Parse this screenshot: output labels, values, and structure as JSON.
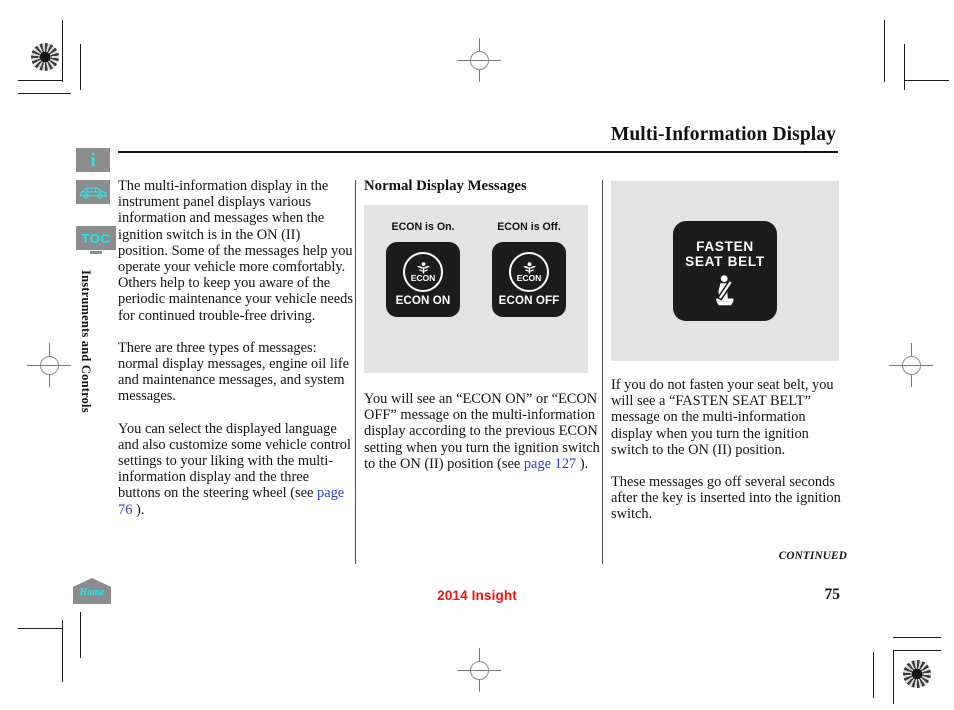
{
  "header": {
    "title": "Multi-Information Display"
  },
  "sidebar": {
    "items": [
      {
        "name": "info-icon",
        "label": "i"
      },
      {
        "name": "vehicle-icon",
        "label": ""
      },
      {
        "name": "toc-icon",
        "label": "TOC"
      }
    ],
    "vertical_label": "Instruments and Controls"
  },
  "left_column": {
    "paragraphs": [
      "The multi-information display in the instrument panel displays various information and messages when the ignition switch is in the ON (II) position. Some of the messages help you operate your vehicle more comfortably. Others help to keep you aware of the periodic maintenance your vehicle needs for continued trouble-free driving.",
      "There are three types of messages: normal display messages, engine oil life and maintenance messages, and system messages."
    ],
    "last_paragraph": {
      "before_link": "You can select the displayed language and also customize some vehicle control settings to your liking with the multi-information display and the three buttons on the steering wheel (see ",
      "link": "page  76",
      "after_link": " )."
    }
  },
  "middle_column": {
    "heading": "Normal Display Messages",
    "figure": {
      "cells": [
        {
          "caption": "ECON is On.",
          "badge_word": "ECON",
          "lcd_label": "ECON ON"
        },
        {
          "caption": "ECON is Off.",
          "badge_word": "ECON",
          "lcd_label": "ECON OFF"
        }
      ]
    },
    "paragraph": {
      "before_link": "You will see an “ECON ON” or “ECON OFF” message on the multi-information display according to the previous ECON setting when you turn the ignition switch to the ON (II) position (see ",
      "link": "page 127",
      "after_link": " )."
    }
  },
  "right_column": {
    "figure": {
      "line1": "FASTEN",
      "line2": "SEAT BELT",
      "icon": "seat-belt-icon"
    },
    "paragraphs": [
      "If you do not fasten your seat belt, you will see a “FASTEN SEAT BELT” message on the multi-information display when you turn the ignition switch to the ON (II) position.",
      "These messages go off several seconds after the key is inserted into the ignition switch."
    ]
  },
  "footer": {
    "continued": "CONTINUED",
    "home_label": "Home",
    "model": "2014 Insight",
    "page_number": "75"
  },
  "colors": {
    "accent_cyan": "#20e8f0",
    "link_blue": "#2b3fd4",
    "model_red": "#ff1111",
    "rail_gray": "#8c8c8c",
    "plate_gray": "#e3e3e3",
    "lcd_black": "#1c1c1c"
  }
}
